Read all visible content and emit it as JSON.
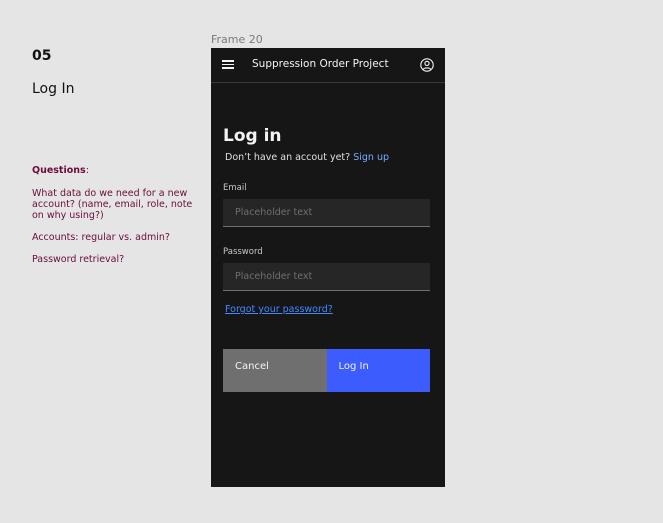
{
  "annotations": {
    "step_number": "05",
    "page_name": "Log In",
    "questions_title": "Questions",
    "questions_colon": ":",
    "questions": [
      "What data do we need for a new account? (name, email, role, note on why using?)",
      "Accounts: regular vs. admin?",
      "Password retrieval?"
    ]
  },
  "frame": {
    "label": "Frame 20"
  },
  "header": {
    "title": "Suppression Order Project",
    "menu_icon": "hamburger-menu-icon",
    "user_icon": "user-avatar-icon"
  },
  "login": {
    "heading": "Log in",
    "no_account_text": "Don’t have an accout yet?",
    "signup_link": "Sign up",
    "email_label": "Email",
    "email_placeholder": "Placeholder text",
    "password_label": "Password",
    "password_placeholder": "Placeholder text",
    "forgot_link": "Forgot your password?",
    "cancel_label": "Cancel",
    "login_label": "Log In"
  },
  "colors": {
    "canvas_bg": "#e5e5e5",
    "phone_bg": "#161616",
    "input_bg": "#262626",
    "link": "#78a9ff",
    "primary_button": "#3c5cfe",
    "secondary_button": "#6f6f6f",
    "annotation_text": "#6b0c3b"
  }
}
